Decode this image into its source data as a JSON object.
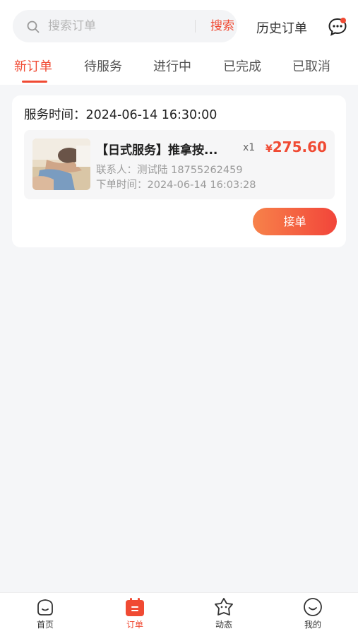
{
  "search": {
    "placeholder": "搜索订单",
    "button_label": "搜索",
    "icon": "search-icon"
  },
  "header": {
    "history_label": "历史订单",
    "message_icon": "message-bubble-icon",
    "has_unread": true
  },
  "tabs": [
    {
      "label": "新订单",
      "active": true
    },
    {
      "label": "待服务",
      "active": false
    },
    {
      "label": "进行中",
      "active": false
    },
    {
      "label": "已完成",
      "active": false
    },
    {
      "label": "已取消",
      "active": false
    }
  ],
  "orders": [
    {
      "service_time": "服务时间：2024-06-14 16:30:00",
      "title": "【日式服务】推拿按...",
      "quantity": "x1",
      "price_symbol": "¥",
      "price": "275.60",
      "contact": "联系人：测试陆 18755262459",
      "order_time": "下单时间：2024-06-14 16:03:28",
      "action_label": "接单"
    }
  ],
  "bottom_nav": [
    {
      "label": "首页",
      "icon": "home-face-icon",
      "active": false
    },
    {
      "label": "订单",
      "icon": "order-calendar-icon",
      "active": true
    },
    {
      "label": "动态",
      "icon": "star-face-icon",
      "active": false
    },
    {
      "label": "我的",
      "icon": "smile-icon",
      "active": false
    }
  ],
  "colors": {
    "accent": "#f04a33",
    "background": "#f5f6f8",
    "button_gradient_start": "#f7824a",
    "button_gradient_end": "#f2453a"
  }
}
